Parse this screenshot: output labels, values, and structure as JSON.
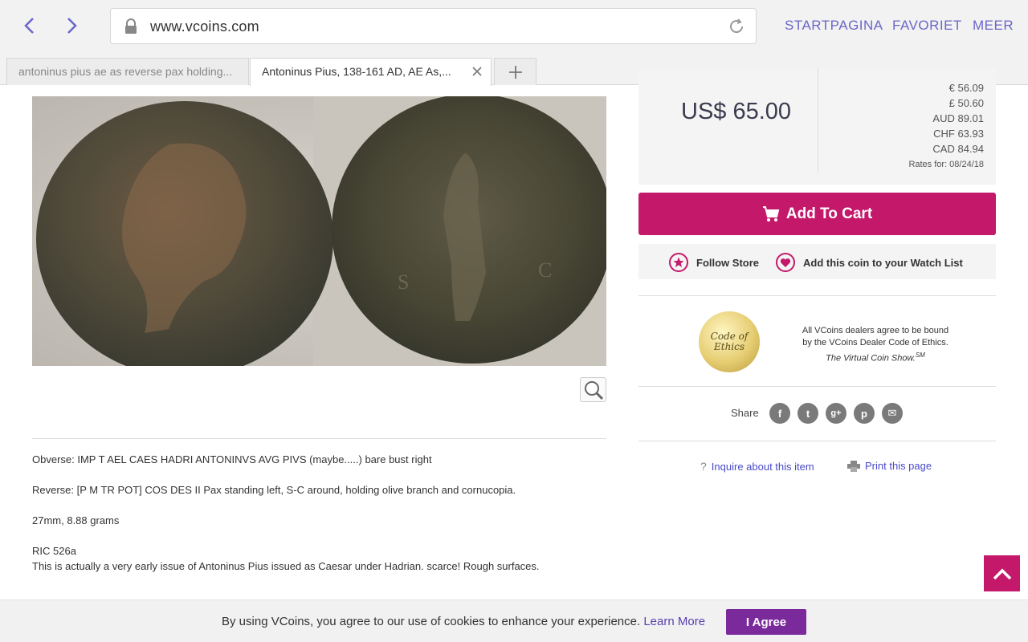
{
  "browser": {
    "url": "www.vcoins.com",
    "menu": [
      "STARTPAGINA",
      "FAVORIET",
      "MEER"
    ],
    "tabs": [
      {
        "label": "antoninus pius ae as reverse pax holding..."
      },
      {
        "label": "Antoninus Pius, 138-161 AD, AE As,..."
      }
    ]
  },
  "price": {
    "main": "US$ 65.00",
    "conversions": [
      "€ 56.09",
      "£ 50.60",
      "AUD 89.01",
      "CHF 63.93",
      "CAD 84.94"
    ],
    "rates_for": "Rates for: 08/24/18"
  },
  "actions": {
    "add_to_cart": "Add To Cart",
    "follow_store": "Follow Store",
    "watch_list": "Add this coin to your Watch List"
  },
  "ethics": {
    "badge_line1": "Code of",
    "badge_line2": "Ethics",
    "line1": "All VCoins dealers agree to be bound",
    "line2": "by the VCoins Dealer Code of Ethics.",
    "line3": "The Virtual Coin Show.",
    "sup": "SM"
  },
  "share": {
    "label": "Share",
    "icons": [
      "f",
      "t",
      "g+",
      "p",
      "✉"
    ]
  },
  "links": {
    "inquire": "Inquire about this item",
    "print": "Print this page"
  },
  "description": {
    "obverse": "Obverse:  IMP T AEL CAES HADRI ANTONINVS AVG PIVS (maybe.....) bare bust right",
    "reverse": "Reverse:  [P M TR POT] COS DES II Pax standing left, S-C around, holding olive branch and cornucopia.",
    "size": "27mm, 8.88 grams",
    "ric": "RIC 526a",
    "note": "This is actually a very early issue of Antoninus Pius issued as Caesar under Hadrian.   scarce!  Rough surfaces."
  },
  "cookie": {
    "text": "By using VCoins, you agree to our use of cookies to enhance your experience. ",
    "learn_more": "Learn More",
    "agree": "I Agree"
  },
  "colors": {
    "accent": "#c4196b",
    "link": "#6b66c8",
    "agree": "#7b2a9c"
  }
}
